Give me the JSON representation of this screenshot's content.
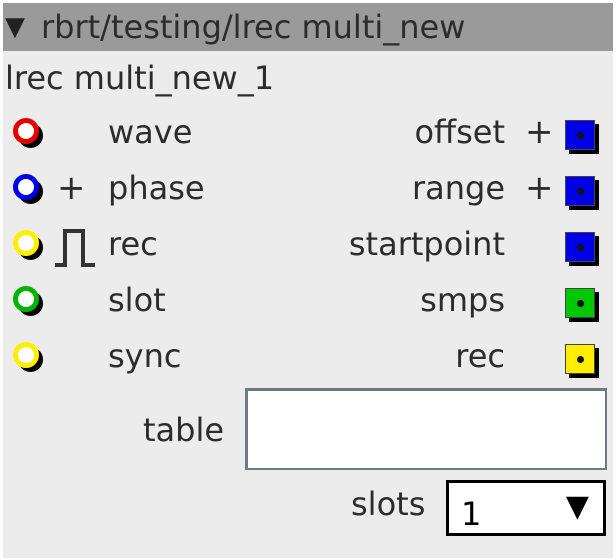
{
  "window": {
    "title": "rbrt/testing/lrec multi_new",
    "collapse_glyph": "▼"
  },
  "module": {
    "name": "lrec multi_new_1"
  },
  "rows": [
    {
      "input": {
        "label": "wave",
        "color": "#e60000",
        "modifier": ""
      },
      "output": {
        "label": "offset",
        "color": "#0000e6",
        "modifier": "+"
      }
    },
    {
      "input": {
        "label": "phase",
        "color": "#0000e6",
        "modifier": "+"
      },
      "output": {
        "label": "range",
        "color": "#0000e6",
        "modifier": "+"
      }
    },
    {
      "input": {
        "label": "rec",
        "color": "#ffee00",
        "modifier": "pulse-icon"
      },
      "output": {
        "label": "startpoint",
        "color": "#0000e6",
        "modifier": ""
      }
    },
    {
      "input": {
        "label": "slot",
        "color": "#00b400",
        "modifier": ""
      },
      "output": {
        "label": "smps",
        "color": "#00c800",
        "modifier": ""
      }
    },
    {
      "input": {
        "label": "sync",
        "color": "#ffee00",
        "modifier": ""
      },
      "output": {
        "label": "rec",
        "color": "#ffee00",
        "modifier": ""
      }
    }
  ],
  "table": {
    "label": "table",
    "value": "",
    "placeholder": ""
  },
  "slots": {
    "label": "slots",
    "selected": "1",
    "caret": "▼"
  }
}
